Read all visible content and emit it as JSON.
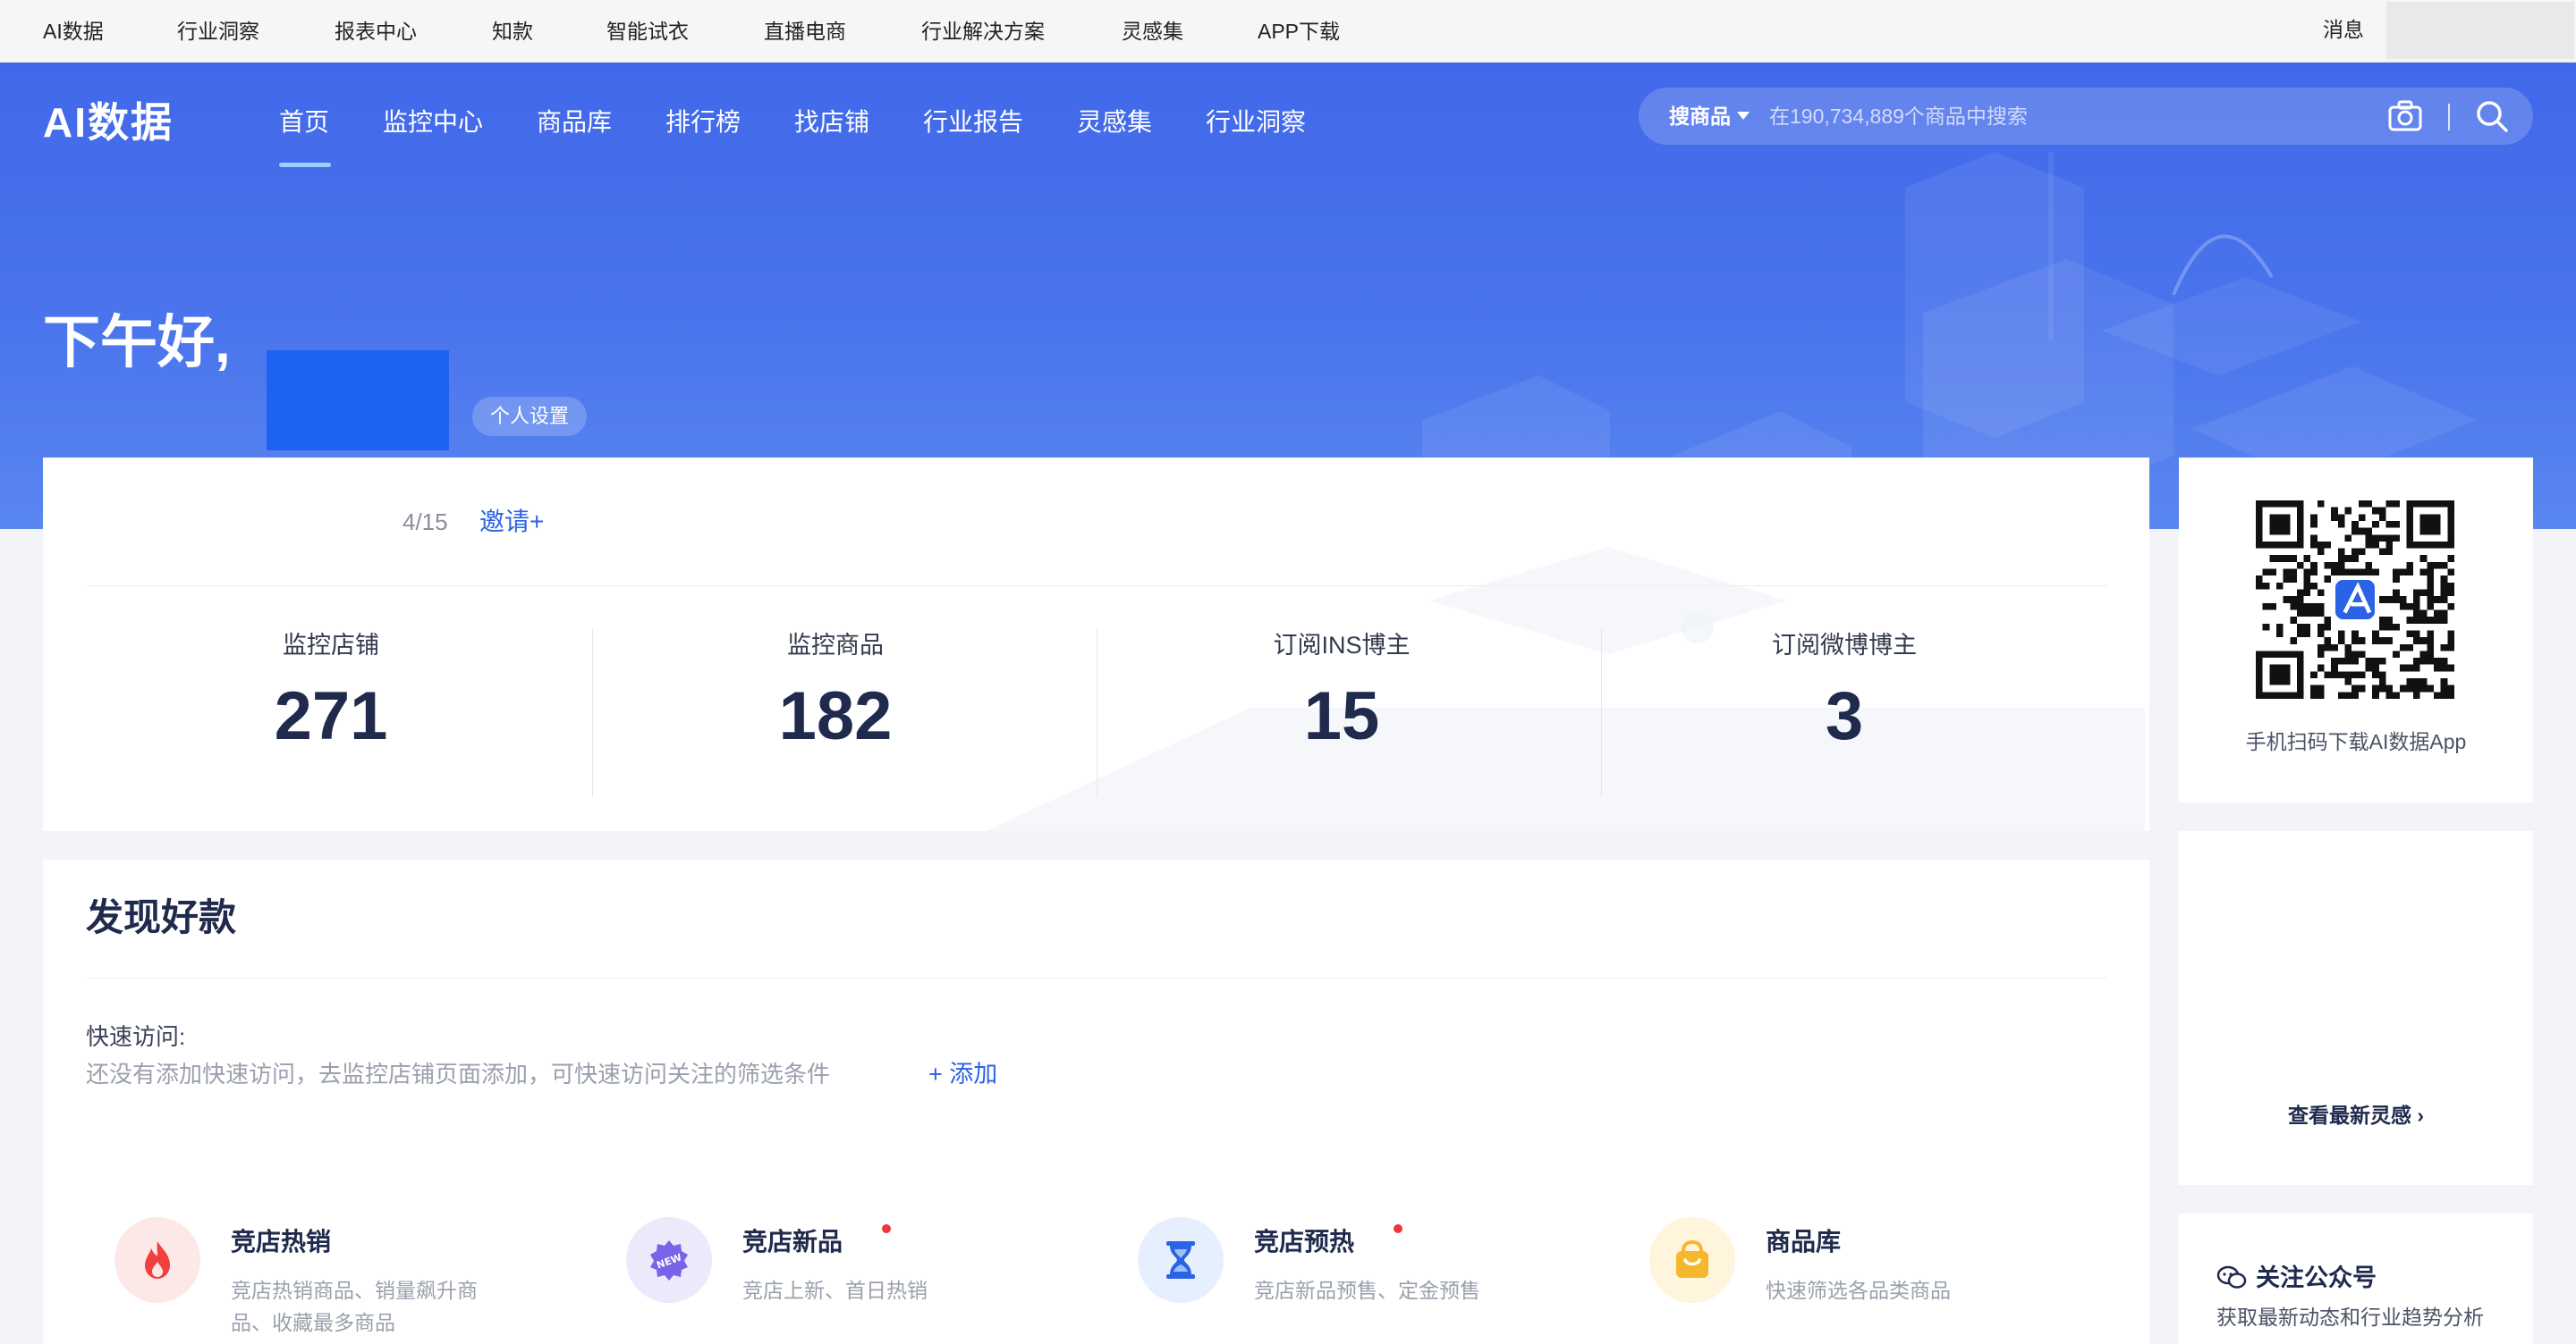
{
  "top_links": [
    "AI数据",
    "行业洞察",
    "报表中心",
    "知款",
    "智能试衣",
    "直播电商",
    "行业解决方案",
    "灵感集",
    "APP下载"
  ],
  "top_message": "消息",
  "brand": {
    "logo": "AI数据",
    "primary_color": "#4168ea",
    "link_color": "#2a63e6"
  },
  "nav": [
    "首页",
    "监控中心",
    "商品库",
    "排行榜",
    "找店铺",
    "行业报告",
    "灵感集",
    "行业洞察"
  ],
  "nav_active": "首页",
  "search": {
    "scope": "搜商品",
    "placeholder": "在190,734,889个商品中搜索",
    "camera_icon": "camera-icon",
    "search_icon": "search-icon"
  },
  "greeting": {
    "text": "下午好,",
    "settings": "个人设置"
  },
  "invite": {
    "count": "4/15",
    "link": "邀请+"
  },
  "stats": [
    {
      "label": "监控店铺",
      "value": "271"
    },
    {
      "label": "监控商品",
      "value": "182"
    },
    {
      "label": "订阅INS博主",
      "value": "15"
    },
    {
      "label": "订阅微博博主",
      "value": "3"
    }
  ],
  "discover": {
    "title": "发现好款",
    "quick_access_label": "快速访问:",
    "quick_access_hint": "还没有添加快速访问，去监控店铺页面添加，可快速访问关注的筛选条件",
    "add_label": "+ 添加",
    "features": [
      {
        "title": "竞店热销",
        "desc": "竞店热销商品、销量飙升商品、收藏最多商品",
        "icon": "flame-icon",
        "dot": false,
        "icon_bg": "#fde8e8",
        "icon_color": "#f0403f"
      },
      {
        "title": "竞店新品",
        "desc": "竞店上新、首日热销",
        "icon": "new-badge-icon",
        "dot": true,
        "icon_bg": "#ece9fb",
        "icon_color": "#7a63e8"
      },
      {
        "title": "竞店预热",
        "desc": "竞店新品预售、定金预售",
        "icon": "hourglass-icon",
        "dot": true,
        "icon_bg": "#e6effd",
        "icon_color": "#2a63e6"
      },
      {
        "title": "商品库",
        "desc": "快速筛选各品类商品",
        "icon": "shopping-bag-icon",
        "dot": false,
        "icon_bg": "#fff4dc",
        "icon_color": "#f5b82c"
      }
    ]
  },
  "qr": {
    "caption": "手机扫码下载AI数据App"
  },
  "inspiration": {
    "link": "查看最新灵感 ›"
  },
  "wechat": {
    "title": "关注公众号",
    "desc": "获取最新动态和行业趋势分析"
  }
}
